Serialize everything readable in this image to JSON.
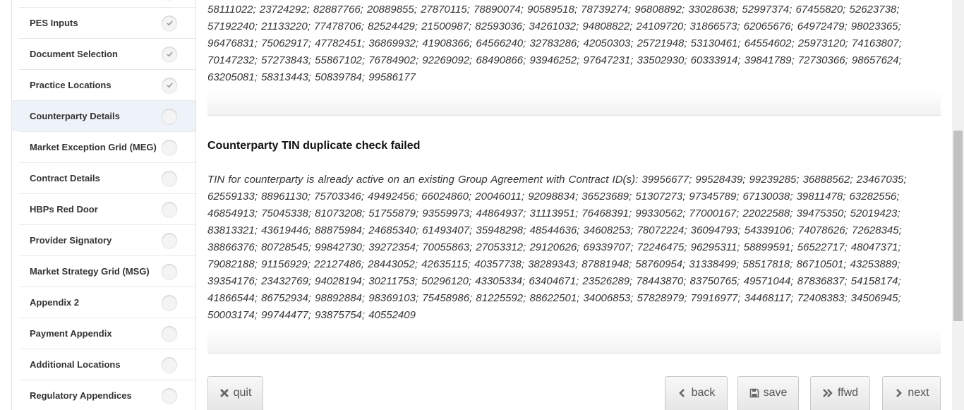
{
  "sidebar": {
    "items": [
      {
        "label": "",
        "complete": true
      },
      {
        "label": "PES Inputs",
        "complete": true
      },
      {
        "label": "Document Selection",
        "complete": true
      },
      {
        "label": "Practice Locations",
        "complete": true
      },
      {
        "label": "Counterparty Details",
        "complete": false,
        "active": true
      },
      {
        "label": "Market Exception Grid (MEG)",
        "complete": false
      },
      {
        "label": "Contract Details",
        "complete": false
      },
      {
        "label": "HBPs Red Door",
        "complete": false
      },
      {
        "label": "Provider Signatory",
        "complete": false
      },
      {
        "label": "Market Strategy Grid (MSG)",
        "complete": false
      },
      {
        "label": "Appendix 2",
        "complete": false
      },
      {
        "label": "Payment Appendix",
        "complete": false
      },
      {
        "label": "Additional Locations",
        "complete": false
      },
      {
        "label": "Regulatory Appendices",
        "complete": false
      }
    ]
  },
  "main": {
    "message1": {
      "text": "58111022; 23724292; 82887766; 20889855; 27870115; 78890074; 90589518; 78739274; 96808892; 33028638; 52997374; 67455820; 52623738; 57192240; 21133220; 77478706; 82524429; 21500987; 82593036; 34261032; 94808822; 24109720; 31866573; 62065676; 64972479; 98023365; 96476831; 75062917; 47782451; 36869932; 41908366; 64566240; 32783286; 42050303; 25721948; 53130461; 64554602; 25973120; 74163807; 70147232; 57273843; 55867102; 76784902; 92269092; 68490866; 93946252; 97647231; 33502930; 60333914; 39841789; 72730366; 98657624; 63205081; 58313443; 50839784; 99586177"
    },
    "message2": {
      "title": "Counterparty TIN duplicate check failed",
      "text": "TIN for counterparty is already active on an existing Group Agreement with Contract ID(s): 39956677; 99528439; 99239285; 36888562; 23467035; 62559133; 88961130; 75703346; 49492456; 66024860; 20046011; 92098834; 36523689; 51307273; 97345789; 67130038; 39811478; 63282556; 46854913; 75045338; 81073208; 51755879; 93559973; 44864937; 31113951; 76468391; 99330562; 77000167; 22022588; 39475350; 52019423; 83813321; 43619446; 88875984; 24685340; 61493407; 35948298; 48544636; 34608253; 78072224; 36094793; 54339106; 74078626; 72628345; 38866376; 80728545; 99842730; 39272354; 70055863; 27053312; 29120626; 69339707; 72246475; 96295311; 58899591; 56522717; 48047371; 79082188; 91156929; 22127486; 28443052; 42635115; 40357738; 38289343; 87881948; 58760954; 31338499; 58517818; 86710501; 43253889; 39354176; 23432769; 94028194; 30211753; 50296120; 43305334; 63404671; 23526289; 78443870; 83750765; 49571044; 87836837; 54158174; 41866544; 86752934; 98892884; 98369103; 75458986; 81225592; 88622501; 34006853; 57828979; 79916977; 34468117; 72408383; 34506945; 50003174; 99744477; 93875754; 40552409"
    }
  },
  "buttons": {
    "quit": "quit",
    "back": "back",
    "save": "save",
    "ffwd": "ffwd",
    "next": "next"
  },
  "icons": {
    "check_color": "#9a9a9a",
    "button_icon_color": "#666666"
  }
}
